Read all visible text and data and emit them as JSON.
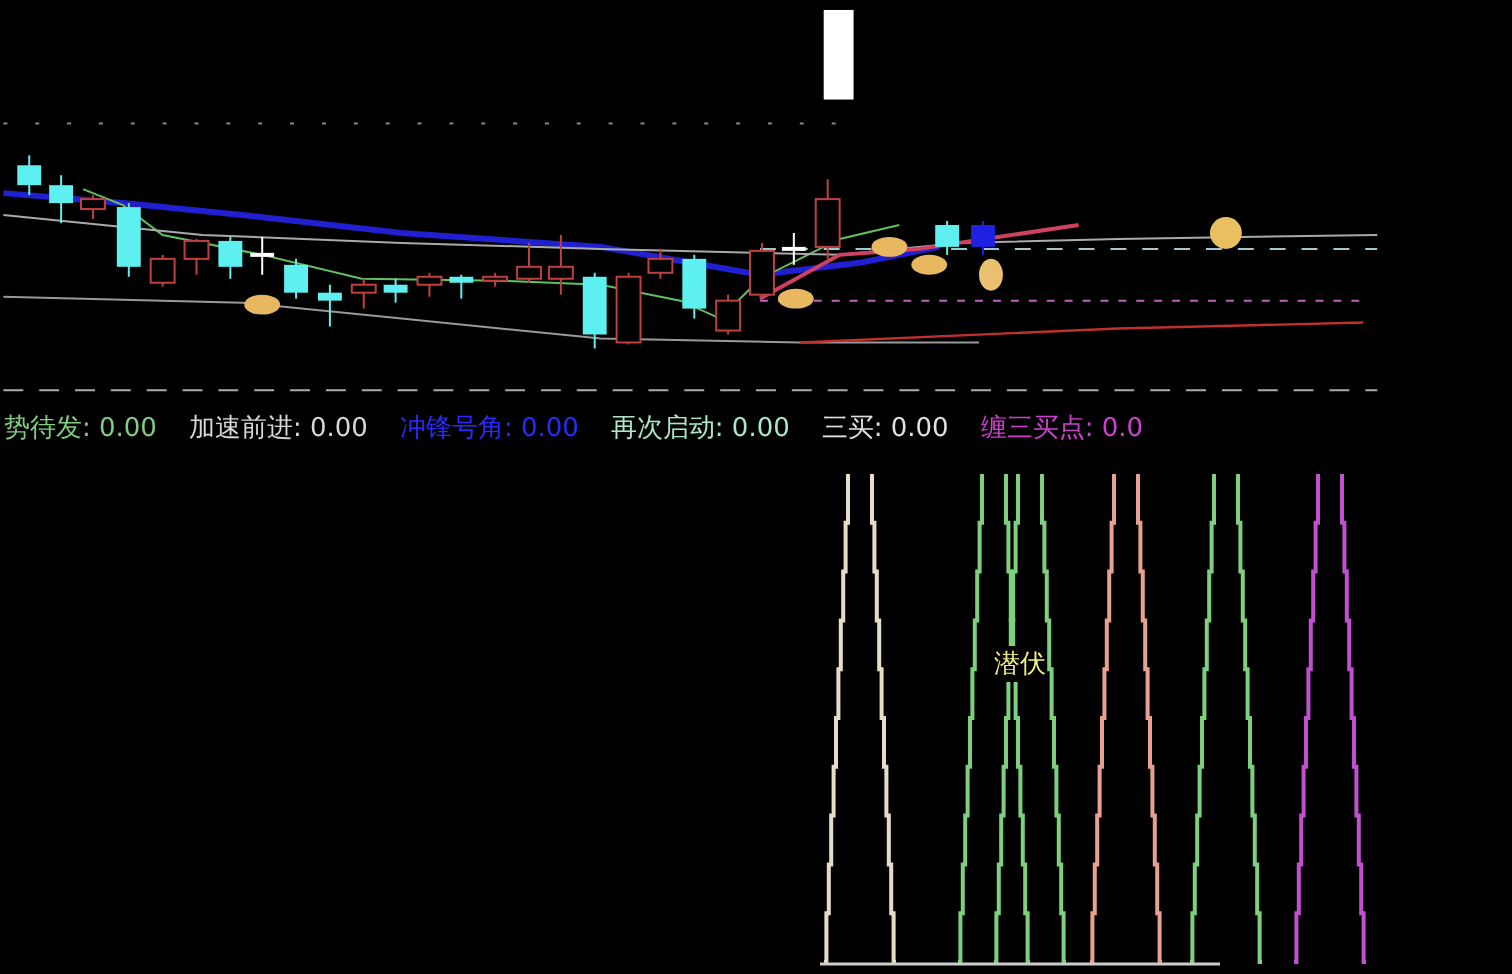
{
  "indicators": [
    {
      "name": "势待发:",
      "value": "0.00",
      "color": "#7ecf7e"
    },
    {
      "name": "加速前进:",
      "value": "0.00",
      "color": "#d8d8d8"
    },
    {
      "name": "冲锋号角:",
      "value": "0.00",
      "color": "#2a2aff"
    },
    {
      "name": "再次启动:",
      "value": "0.00",
      "color": "#a8e8c8"
    },
    {
      "name": "三买:",
      "value": "0.00",
      "color": "#e0e0e0"
    },
    {
      "name": "缠三买点:",
      "value": "0.0",
      "color": "#d040d0"
    }
  ],
  "lower_pane": {
    "label": "潜伏"
  }
}
